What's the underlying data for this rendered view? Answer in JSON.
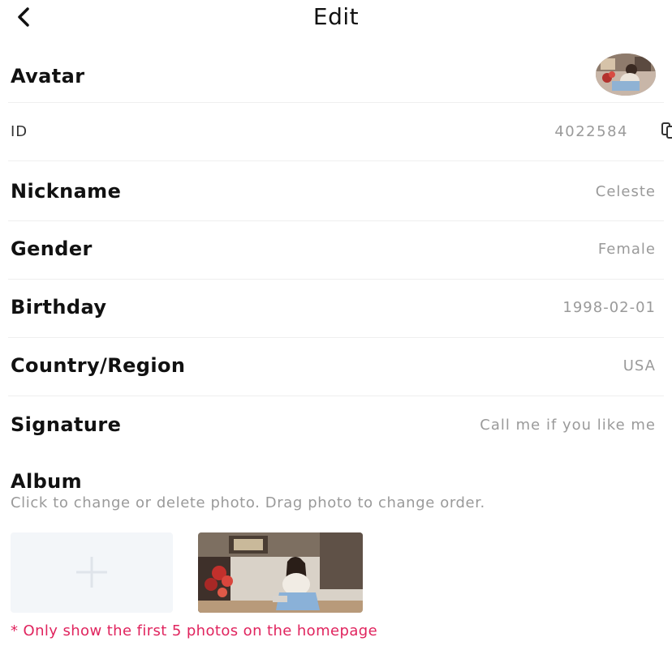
{
  "header": {
    "title": "Edit",
    "back_icon": "chevron-left-icon"
  },
  "avatar_row": {
    "label": "Avatar"
  },
  "id_row": {
    "label": "ID",
    "value": "4022584",
    "copy_icon": "copy-icon"
  },
  "fields": {
    "nickname": {
      "label": "Nickname",
      "value": "Celeste"
    },
    "gender": {
      "label": "Gender",
      "value": "Female"
    },
    "birthday": {
      "label": "Birthday",
      "value": "1998-02-01"
    },
    "country": {
      "label": "Country/Region",
      "value": "USA"
    },
    "signature": {
      "label": "Signature",
      "value": "Call me if you like me"
    }
  },
  "album": {
    "title": "Album",
    "hint": "Click to change or delete photo. Drag photo to change order.",
    "add_icon": "plus-icon",
    "note": "* Only show the first 5 photos on the homepage"
  },
  "colors": {
    "note_red": "#e0245e",
    "value_gray": "#9a9a9a",
    "tile_bg": "#f3f6f9"
  }
}
